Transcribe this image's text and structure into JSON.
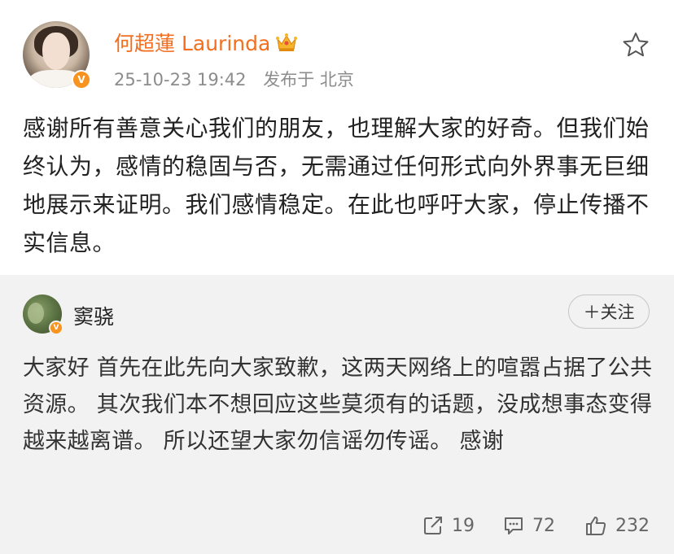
{
  "post": {
    "author": "何超蓮 Laurinda",
    "verified_badge": "V",
    "crown_icon": "crown-icon",
    "date": "25-10-23 19:42",
    "location": "发布于 北京",
    "text": "感谢所有善意关心我们的朋友，也理解大家的好奇。但我们始终认为，感情的稳固与否，无需通过任何形式向外界事无巨细地展示来证明。我们感情稳定。在此也呼吁大家，停止传播不实信息。",
    "favorite_icon": "star-icon"
  },
  "repost": {
    "author": "窦骁",
    "verified_badge": "V",
    "follow_label": "＋关注",
    "text": "大家好 首先在此先向大家致歉，这两天网络上的喧嚣占据了公共资源。 其次我们本不想回应这些莫须有的话题，没成想事态变得越来越离谱。 所以还望大家勿信谣勿传谣。 感谢",
    "stats": {
      "reposts": "19",
      "comments": "72",
      "likes": "232"
    }
  },
  "colors": {
    "name_orange": "#f36e1f",
    "badge_orange": "#f7931e",
    "repost_bg": "#f2f2f2"
  }
}
